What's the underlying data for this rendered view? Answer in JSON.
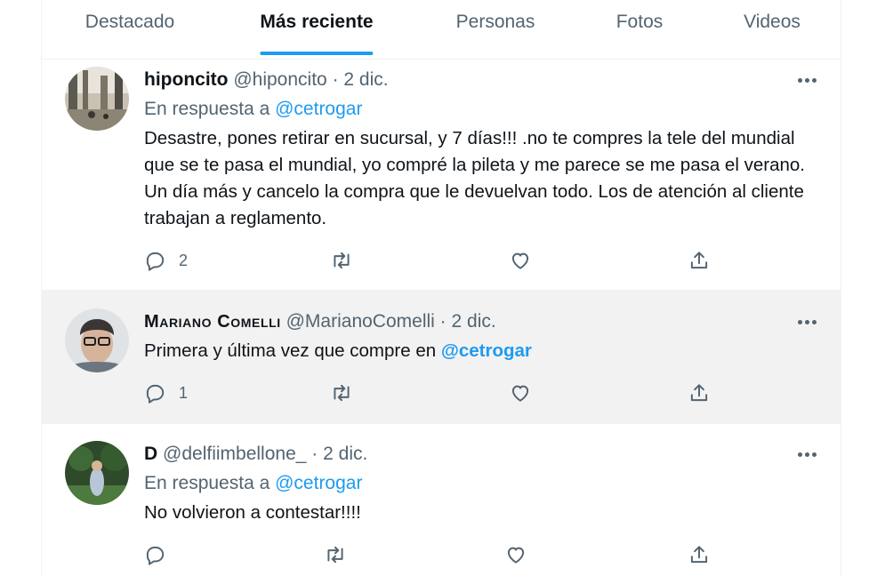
{
  "tabs": [
    {
      "label": "Destacado",
      "active": false
    },
    {
      "label": "Más reciente",
      "active": true
    },
    {
      "label": "Personas",
      "active": false
    },
    {
      "label": "Fotos",
      "active": false
    },
    {
      "label": "Videos",
      "active": false
    }
  ],
  "tweets": [
    {
      "name": "hiponcito",
      "handle": "@hiponcito",
      "separator": "·",
      "time": "2 dic.",
      "reply_prefix": "En respuesta a",
      "reply_mention": "@cetrogar",
      "text": "Desastre, pones retirar en sucursal, y 7 días!!! .no te compres la tele del mundial que se te pasa el mundial, yo compré la pileta y me parece se me pasa el verano. Un día más y cancelo la compra que le devuelvan todo. Los de atención al cliente trabajan a reglamento.",
      "reply_count": "2"
    },
    {
      "name": "Mariano Comelli",
      "handle": "@MarianoComelli",
      "separator": "·",
      "time": "2 dic.",
      "text_prefix": "Primera y última vez que compre en",
      "text_mention": "@cetrogar",
      "reply_count": "1"
    },
    {
      "name": "D",
      "handle": "@delfiimbellone_",
      "separator": "·",
      "time": "2 dic.",
      "reply_prefix": "En respuesta a",
      "reply_mention": "@cetrogar",
      "text": "No volvieron a contestar!!!!"
    }
  ],
  "colors": {
    "accent": "#1d9bf0",
    "secondary_text": "#536471",
    "highlight_bg": "#f2f2f2"
  },
  "icons": [
    "reply-icon",
    "retweet-icon",
    "like-icon",
    "share-icon",
    "more-icon"
  ]
}
